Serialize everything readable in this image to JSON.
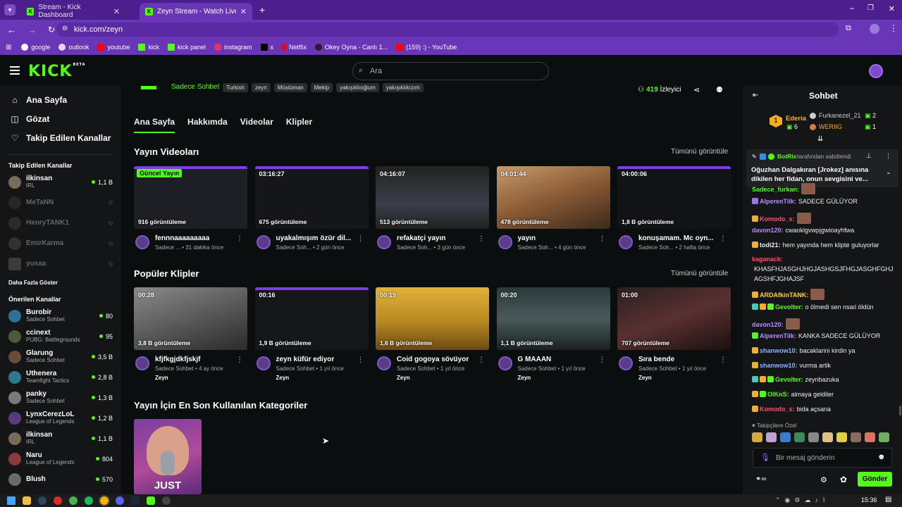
{
  "browser": {
    "tabs": [
      {
        "label": "Stream - Kick Dashboard"
      },
      {
        "label": "Zeyn Stream - Watch Live on Kick"
      }
    ],
    "url": "kick.com/zeyn",
    "bookmarks": [
      "google",
      "outlook",
      "youtube",
      "kick",
      "kick panel",
      "instagram",
      "x",
      "Netflix",
      "Okey Oyna - Canlı 1...",
      "(159) :) - YouTube"
    ]
  },
  "header": {
    "logo": "KICK",
    "logo_beta": "BETA",
    "search_placeholder": "Ara"
  },
  "sidebar": {
    "nav": [
      {
        "label": "Ana Sayfa",
        "icon": "home-icon"
      },
      {
        "label": "Gözat",
        "icon": "browse-icon"
      },
      {
        "label": "Takip Edilen Kanallar",
        "icon": "heart-icon"
      }
    ],
    "following_title": "Takip Edilen Kanallar",
    "following": [
      {
        "name": "ilkinsan",
        "cat": "IRL",
        "viewers": "1,1 B",
        "online": true
      },
      {
        "name": "MeTaNN",
        "online": false
      },
      {
        "name": "HenryTANK1",
        "online": false
      },
      {
        "name": "EmirKarma",
        "online": false
      },
      {
        "name": "yusaa",
        "online": false
      }
    ],
    "show_more": "Daha Fazla Göster",
    "recommended_title": "Önerilen Kanallar",
    "recommended": [
      {
        "name": "Burobir",
        "cat": "Sadece Sohbet",
        "viewers": "80"
      },
      {
        "name": "ccinext",
        "cat": "PUBG: Battlegrounds",
        "viewers": "95"
      },
      {
        "name": "Glarung",
        "cat": "Sadece Sohbet",
        "viewers": "3,5 B"
      },
      {
        "name": "Uthenera",
        "cat": "Teamfight Tactics",
        "viewers": "2,8 B"
      },
      {
        "name": "panky",
        "cat": "Sadece Sohbet",
        "viewers": "1,3 B"
      },
      {
        "name": "LynxCerezLoL",
        "cat": "League of Legends",
        "viewers": "1,2 B"
      },
      {
        "name": "ilkinsan",
        "cat": "IRL",
        "viewers": "1,1 B"
      },
      {
        "name": "Naru",
        "cat": "League of Legends",
        "viewers": "804"
      },
      {
        "name": "Blush",
        "cat": "",
        "viewers": "570"
      }
    ]
  },
  "stream": {
    "category": "Sadece Sohbet",
    "tags": [
      "Turkish",
      "zeyn",
      "Müslüman",
      "Mekip",
      "yakışıklıoğlum",
      "yakışıklıkızım"
    ],
    "viewers": "419",
    "viewers_label": "İzleyici"
  },
  "content_tabs": [
    "Ana Sayfa",
    "Hakkımda",
    "Videolar",
    "Klipler"
  ],
  "videos": {
    "title": "Yayın Videoları",
    "see_all": "Tümünü görüntüle",
    "items": [
      {
        "duration": "Güncel Yayın",
        "views": "916 görüntüleme",
        "title": "fennnaaaaaaaaa",
        "meta": "Sadece ... • 31 dakika önce"
      },
      {
        "duration": "03:16:27",
        "views": "675 görüntüleme",
        "title": "uyakalmışım özür dil...",
        "meta": "Sadece Soh... • 2 gün önce"
      },
      {
        "duration": "04:16:07",
        "views": "513 görüntüleme",
        "title": "refakatçi yayın",
        "meta": "Sadece Soh... • 3 gün önce"
      },
      {
        "duration": "04:01:44",
        "views": "478 görüntüleme",
        "title": "yayın",
        "meta": "Sadece Soh... • 4 gün önce"
      },
      {
        "duration": "04:00:06",
        "views": "1,8 B görüntüleme",
        "title": "konuşamam. Mc oyn...",
        "meta": "Sadece Soh... • 2 hafta önce"
      }
    ]
  },
  "clips": {
    "title": "Popüler Klipler",
    "see_all": "Tümünü görüntüle",
    "items": [
      {
        "duration": "00:28",
        "views": "3,8 B görüntüleme",
        "title": "kfjfkgjdkfjskjf",
        "meta": "Sadece Sohbet • 4 ay önce",
        "by": "Zeyn"
      },
      {
        "duration": "00:16",
        "views": "1,9 B görüntüleme",
        "title": "zeyn küfür ediyor",
        "meta": "Sadece Sohbet • 1 yıl önce",
        "by": "Zeyn"
      },
      {
        "duration": "00:19",
        "views": "1,6 B görüntüleme",
        "title": "Coid gogoya sövüyor",
        "meta": "Sadece Sohbet • 1 yıl önce",
        "by": "Zeyn"
      },
      {
        "duration": "00:20",
        "views": "1,1 B görüntüleme",
        "title": "G MAAAN",
        "meta": "Sadece Sohbet • 1 yıl önce",
        "by": "Zeyn"
      },
      {
        "duration": "01:00",
        "views": "707 görüntüleme",
        "title": "Sıra bende",
        "meta": "Sadece Sohbet • 1 yıl önce",
        "by": "Zeyn"
      }
    ]
  },
  "categories": {
    "title": "Yayın İçin En Son Kullanılan Kategoriler",
    "card_text": "JUST"
  },
  "chat": {
    "title": "Sohbet",
    "leaders": [
      {
        "rank": "1",
        "name": "Ederia",
        "count": "6"
      },
      {
        "name": "Furkanezel_21",
        "count": "2"
      },
      {
        "name": "WERIIG",
        "count": "1"
      }
    ],
    "pinned_by": "BotRix",
    "pinned_suffix": "tarafından sabitlendi",
    "pinned_text_1": "Oğuzhan Dalgakıran [Jrokez] anısına",
    "pinned_text_2": "dikilen her fidan, onun sevgisini ve...",
    "messages": [
      {
        "user": "Sadece_furkan:",
        "text": "",
        "color": "#53fc18"
      },
      {
        "user": "AlperenTilk:",
        "text": "SADECE GÜLÜYOR",
        "color": "#b98cff"
      },
      {
        "user": "Komodo_s:",
        "text": "",
        "color": "#ff4d6d"
      },
      {
        "user": "davon120:",
        "text": "cwaoklgvwpjgwioayhfwa",
        "color": "#b98cff"
      },
      {
        "user": "todi21:",
        "text": "hem yayında hem klipte guluyorlar",
        "color": "#efeff1"
      },
      {
        "user": "kaganack:",
        "text": "",
        "color": "#ff4d6d"
      },
      {
        "user": "",
        "text": "KHASFHJASGHJHGJASHGSJFHGJASGHFGHJ",
        "color": "#efeff1"
      },
      {
        "user": "",
        "text": "AGSHFJGHAJSF",
        "color": "#efeff1"
      },
      {
        "user": "ARDAfkinTANK:",
        "text": "",
        "color": "#ffcf3d"
      },
      {
        "user": "Gevolter:",
        "text": "o ölmedi sen nsaıl öldün",
        "color": "#53fc18"
      },
      {
        "user": "davon120:",
        "text": "",
        "color": "#b98cff"
      },
      {
        "user": "AlperenTilk:",
        "text": "KANKA SADECE GÜLÜYOR",
        "color": "#b98cff"
      },
      {
        "user": "shanwow10:",
        "text": "bacaklarini kirdin ya",
        "color": "#8ab4ff"
      },
      {
        "user": "shanwow10:",
        "text": "vurma artik",
        "color": "#8ab4ff"
      },
      {
        "user": "Gevolter:",
        "text": "zeynbazuka",
        "color": "#53fc18"
      },
      {
        "user": "OlKnS:",
        "text": "almaya geldiler",
        "color": "#53fc18"
      },
      {
        "user": "Komodo_s:",
        "text": "bida açsana",
        "color": "#ff4d6d"
      }
    ],
    "followers_only": "Takipçilere Özel",
    "input_placeholder": "Bir mesaj gönderin",
    "send_label": "Gönder"
  },
  "taskbar": {
    "time": "15:36"
  },
  "colors": {
    "accent": "#53fc18",
    "browser": "#6a36b8",
    "bg": "#0b0e0f",
    "panel": "#141517"
  }
}
